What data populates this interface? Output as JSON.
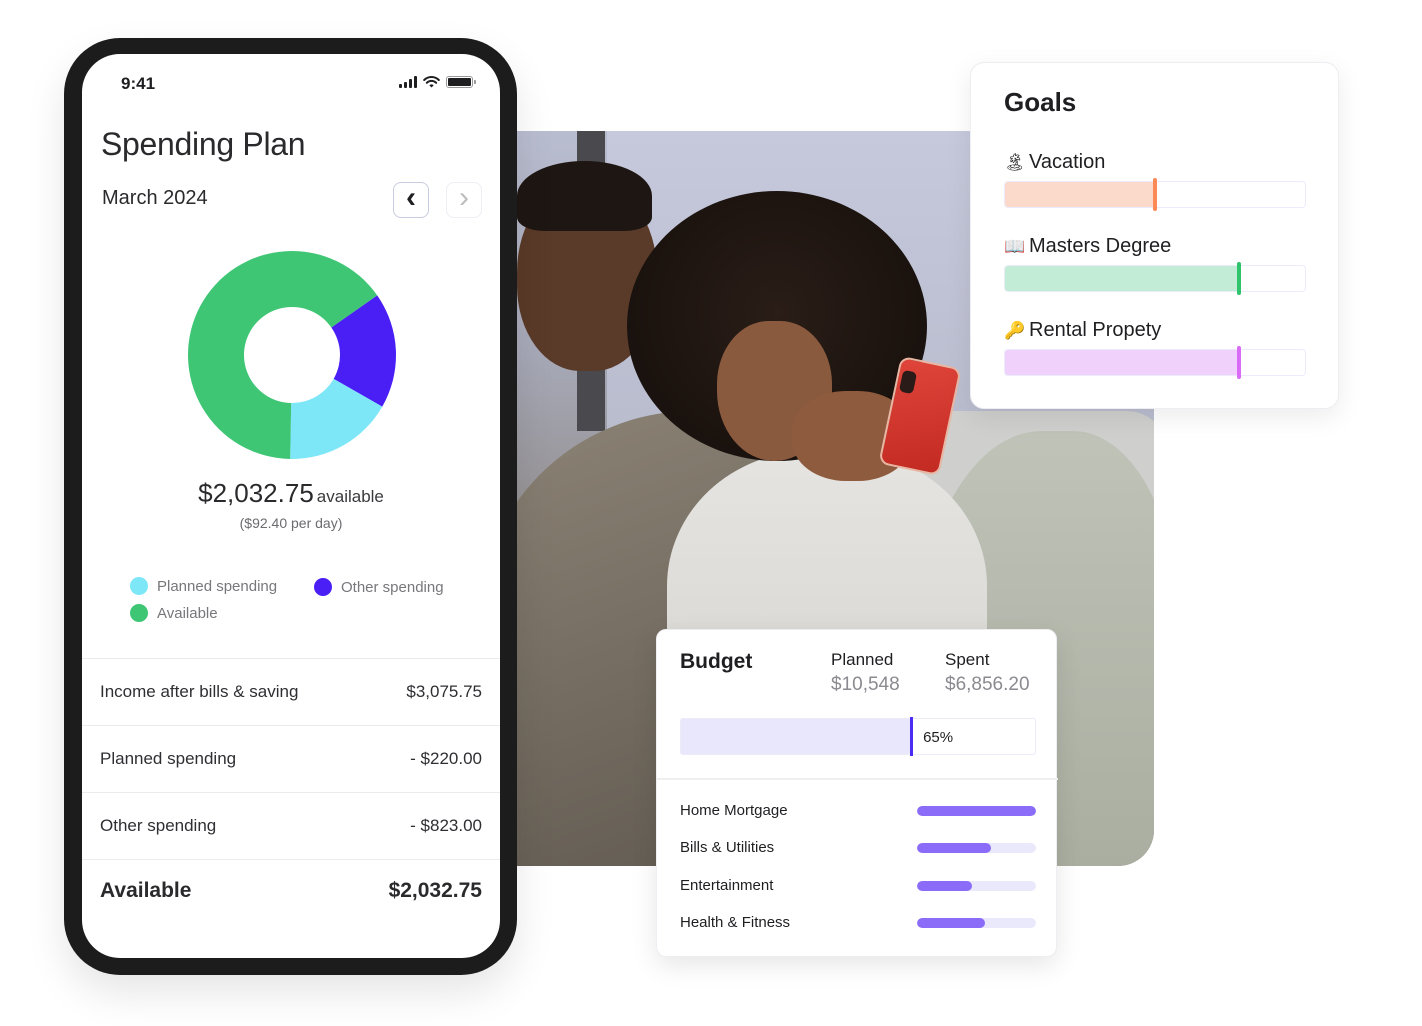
{
  "phone": {
    "status_bar": {
      "time": "9:41",
      "icons": [
        "signal-icon",
        "wifi-icon",
        "battery-icon"
      ]
    },
    "title": "Spending Plan",
    "month": "March 2024",
    "nav": {
      "prev_icon": "chevron-left-icon",
      "next_icon": "chevron-right-icon",
      "prev_glyph": "‹",
      "next_glyph": "›"
    },
    "available": {
      "amount": "$2,032.75",
      "suffix": "available",
      "per_day": "($92.40 per day)"
    },
    "legend": [
      {
        "label": "Planned spending",
        "color": "#7de7f8"
      },
      {
        "label": "Other spending",
        "color": "#4a1ff5"
      },
      {
        "label": "Available",
        "color": "#3ec675"
      }
    ],
    "rows": [
      {
        "label": "Income after bills & saving",
        "value": "$3,075.75"
      },
      {
        "label": "Planned spending",
        "value": "- $220.00"
      },
      {
        "label": "Other spending",
        "value": "- $823.00"
      }
    ],
    "total": {
      "label": "Available",
      "value": "$2,032.75"
    }
  },
  "chart_data": {
    "type": "pie",
    "title": "",
    "donut": true,
    "start_angle_deg": 55,
    "categories": [
      "Other spending",
      "Planned spending",
      "Available"
    ],
    "values": [
      18,
      17,
      65
    ],
    "units": "percent (estimated from arc angles)",
    "colors": [
      "#4a1ff5",
      "#7de7f8",
      "#3ec675"
    ],
    "legend": [
      "Planned spending",
      "Other spending",
      "Available"
    ]
  },
  "goals": {
    "title": "Goals",
    "items": [
      {
        "emoji": "🏝",
        "icon": "island-icon",
        "label": "Vacation",
        "progress": 0.5,
        "fill": "#fcdacb",
        "marker": "#fb8a56"
      },
      {
        "emoji": "📖",
        "icon": "book-icon",
        "label": "Masters Degree",
        "progress": 0.78,
        "fill": "#c3ecd6",
        "marker": "#2fc46c"
      },
      {
        "emoji": "🔑",
        "icon": "key-icon",
        "label": "Rental Propety",
        "progress": 0.78,
        "fill": "#efd1fb",
        "marker": "#d96bf6"
      }
    ]
  },
  "budget": {
    "title": "Budget",
    "planned_label": "Planned",
    "planned_value": "$10,548",
    "spent_label": "Spent",
    "spent_value": "$6,856.20",
    "progress": 0.65,
    "progress_label": "65%",
    "categories": [
      {
        "label": "Home Mortgage",
        "progress": 1.0
      },
      {
        "label": "Bills & Utilities",
        "progress": 0.62
      },
      {
        "label": "Entertainment",
        "progress": 0.46
      },
      {
        "label": "Health & Fitness",
        "progress": 0.57
      }
    ]
  }
}
